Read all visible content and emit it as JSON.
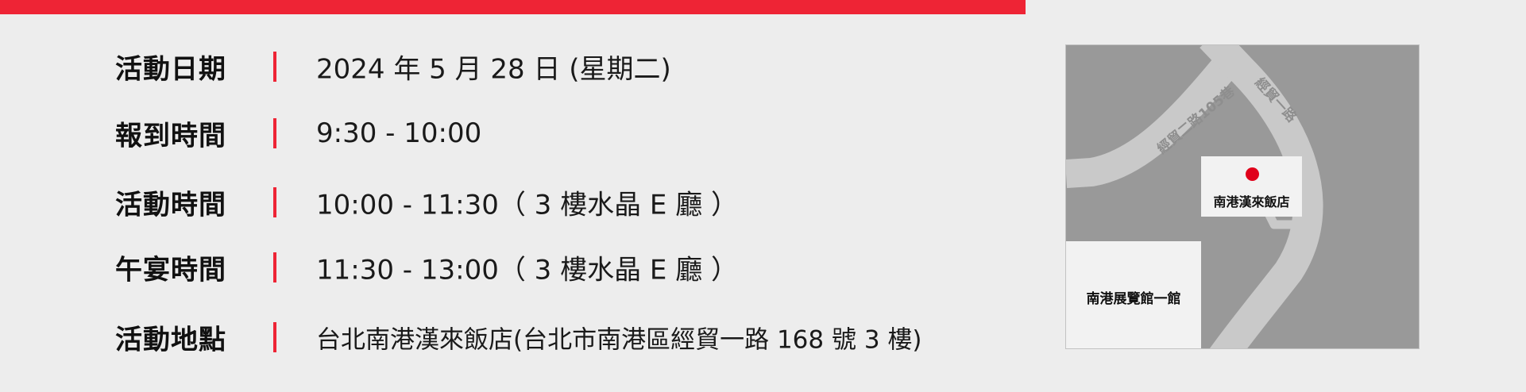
{
  "event": {
    "rows": [
      {
        "label": "活動日期",
        "value": "2024 年 5 月 28 日 (星期二)"
      },
      {
        "label": "報到時間",
        "value": "9:30 - 10:00"
      },
      {
        "label": "活動時間",
        "value": "10:00 - 11:30（ 3 樓水晶 E 廳 ）"
      },
      {
        "label": "午宴時間",
        "value": "11:30  - 13:00（ 3 樓水晶 E 廳 ）"
      },
      {
        "label": "活動地點",
        "value": "台北南港漢來飯店(台北市南港區經貿一路 168 號 3 樓)"
      }
    ]
  },
  "map": {
    "hotel_label": "南港漢來飯店",
    "hall_label": "南港展覽館一館",
    "road_upper_label": "經貿二路105巷",
    "road_right_label": "經貿一路"
  },
  "colors": {
    "accent": "#ee2435",
    "background": "#ededed",
    "map_block": "#999999",
    "road": "#c9c9c9",
    "pin": "#e0001a"
  }
}
